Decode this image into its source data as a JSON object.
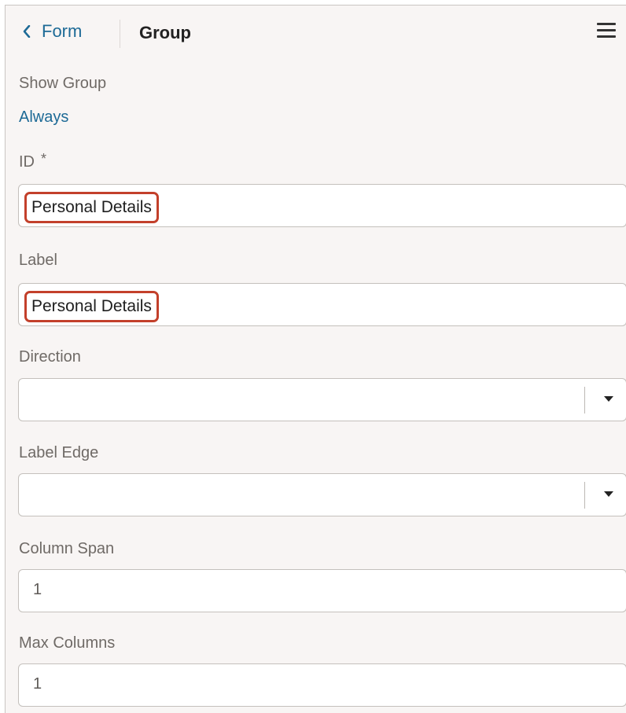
{
  "header": {
    "back_label": "Form",
    "title": "Group"
  },
  "show_group": {
    "label": "Show Group",
    "value": "Always"
  },
  "id_field": {
    "label": "ID",
    "required_marker": "*",
    "value": "Personal Details"
  },
  "label_field": {
    "label": "Label",
    "value": "Personal Details"
  },
  "direction": {
    "label": "Direction",
    "value": ""
  },
  "label_edge": {
    "label": "Label Edge",
    "value": ""
  },
  "column_span": {
    "label": "Column Span",
    "value": "1"
  },
  "max_columns": {
    "label": "Max Columns",
    "value": "1"
  },
  "colors": {
    "accent": "#1d6a96",
    "highlight": "#c3402b",
    "panel_bg": "#f8f5f4"
  },
  "icons": [
    "chevron-left-icon",
    "hamburger-menu-icon",
    "caret-down-icon"
  ]
}
